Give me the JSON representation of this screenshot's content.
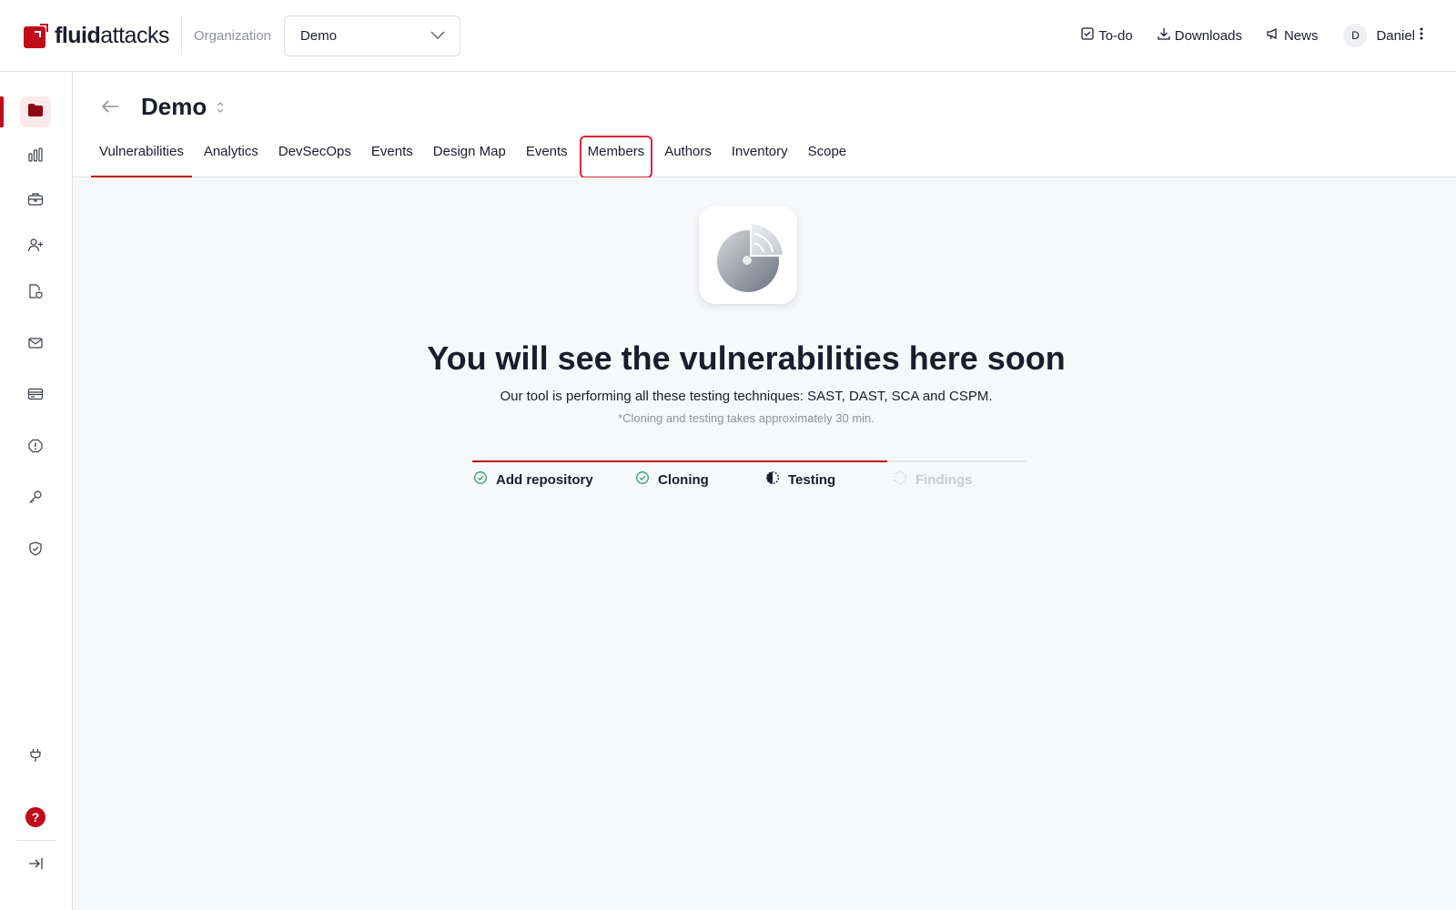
{
  "logo": {
    "bold": "fluid",
    "light": "attacks"
  },
  "organization": {
    "label": "Organization",
    "selected": "Demo"
  },
  "top_actions": [
    {
      "label": "To-do",
      "icon": "todo-icon"
    },
    {
      "label": "Downloads",
      "icon": "download-icon"
    },
    {
      "label": "News",
      "icon": "megaphone-icon"
    }
  ],
  "user": {
    "initial": "D",
    "name": "Daniel"
  },
  "sidebar": {
    "items": [
      {
        "name": "groups",
        "icon": "folder-icon",
        "active": true
      },
      {
        "name": "analytics",
        "icon": "bar-chart-icon"
      },
      {
        "name": "portfolio",
        "icon": "briefcase-icon"
      },
      {
        "name": "members",
        "icon": "user-plus-icon"
      },
      {
        "name": "policies",
        "icon": "file-shield-icon"
      },
      {
        "name": "messages",
        "icon": "mail-icon"
      },
      {
        "name": "billing",
        "icon": "credit-card-icon"
      },
      {
        "name": "alerts",
        "icon": "alert-icon"
      },
      {
        "name": "credentials",
        "icon": "key-icon"
      },
      {
        "name": "compliance",
        "icon": "shield-check-icon"
      },
      {
        "name": "integrations",
        "icon": "plug-icon"
      }
    ],
    "help_label": "?"
  },
  "header": {
    "title": "Demo",
    "tabs": [
      {
        "label": "Vulnerabilities",
        "active": true
      },
      {
        "label": "Analytics"
      },
      {
        "label": "DevSecOps"
      },
      {
        "label": "Events"
      },
      {
        "label": "Design Map"
      },
      {
        "label": "Events"
      },
      {
        "label": "Members",
        "highlighted": true
      },
      {
        "label": "Authors"
      },
      {
        "label": "Inventory"
      },
      {
        "label": "Scope"
      }
    ]
  },
  "main": {
    "headline": "You will see the vulnerabilities here soon",
    "subline": "Our tool is performing all these testing techniques: SAST, DAST, SCA and CSPM.",
    "note": "*Cloning and testing takes approximately 30 min.",
    "progress": 0.75,
    "steps": [
      {
        "label": "Add repository",
        "status": "done"
      },
      {
        "label": "Cloning",
        "status": "done"
      },
      {
        "label": "Testing",
        "status": "in-progress"
      },
      {
        "label": "Findings",
        "status": "pending"
      }
    ]
  },
  "colors": {
    "brand": "#bf0b1a",
    "success": "#2e9e6a",
    "text": "#1a1d2b",
    "muted": "#8f929c"
  }
}
